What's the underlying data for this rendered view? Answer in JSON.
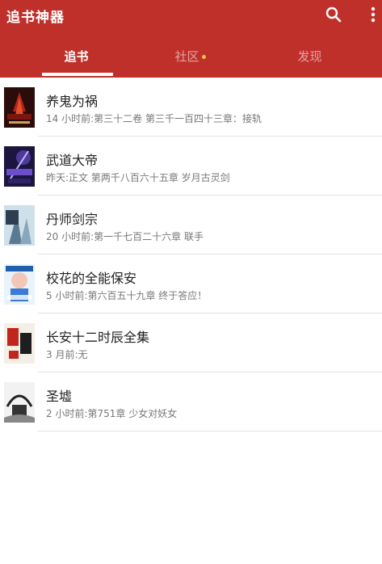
{
  "app": {
    "title": "追书神器"
  },
  "icons": {
    "search": "search-icon",
    "more": "more-vert-icon"
  },
  "colors": {
    "header": "#c0302b",
    "tab_dot": "#f5c242"
  },
  "tabs": [
    {
      "label": "追书",
      "active": true
    },
    {
      "label": "社区",
      "active": false,
      "has_dot": true
    },
    {
      "label": "发现",
      "active": false
    }
  ],
  "books": [
    {
      "title": "养鬼为祸",
      "subtitle": "14 小时前:第三十二卷 第三千一百四十三章：接轨"
    },
    {
      "title": "武道大帝",
      "subtitle": "昨天:正文 第两千八百六十五章 岁月古灵剑"
    },
    {
      "title": "丹师剑宗",
      "subtitle": "20 小时前:第一千七百二十六章 联手"
    },
    {
      "title": "校花的全能保安",
      "subtitle": "5 小时前:第六百五十九章 终于答应！"
    },
    {
      "title": "长安十二时辰全集",
      "subtitle": "3 月前:无"
    },
    {
      "title": "圣墟",
      "subtitle": "2 小时前:第751章 少女对妖女"
    }
  ]
}
